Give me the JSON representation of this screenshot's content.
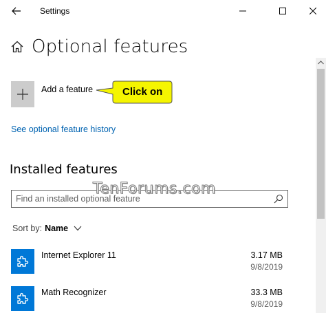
{
  "window": {
    "title": "Settings"
  },
  "header": {
    "title": "Optional features"
  },
  "add_feature": {
    "label": "Add a feature"
  },
  "callout": {
    "text": "Click on",
    "color": "#f5f500"
  },
  "history_link": {
    "label": "See optional feature history"
  },
  "installed": {
    "title": "Installed features",
    "search_placeholder": "Find an installed optional feature",
    "sort_label": "Sort by:",
    "sort_value": "Name",
    "items": [
      {
        "name": "Internet Explorer 11",
        "size": "3.17 MB",
        "date": "9/8/2019"
      },
      {
        "name": "Math Recognizer",
        "size": "33.3 MB",
        "date": "9/8/2019"
      }
    ]
  },
  "watermark": {
    "text": "TenForums.com"
  },
  "colors": {
    "accent": "#0078d7",
    "link": "#0063b1",
    "tile": "#cccccc"
  },
  "icons": {
    "back": "back-arrow-icon",
    "minimize": "minimize-icon",
    "maximize": "maximize-icon",
    "close": "close-icon",
    "home": "home-icon",
    "add": "plus-icon",
    "search": "search-icon",
    "feature": "puzzle-piece-icon",
    "sort": "chevron-down-icon"
  }
}
